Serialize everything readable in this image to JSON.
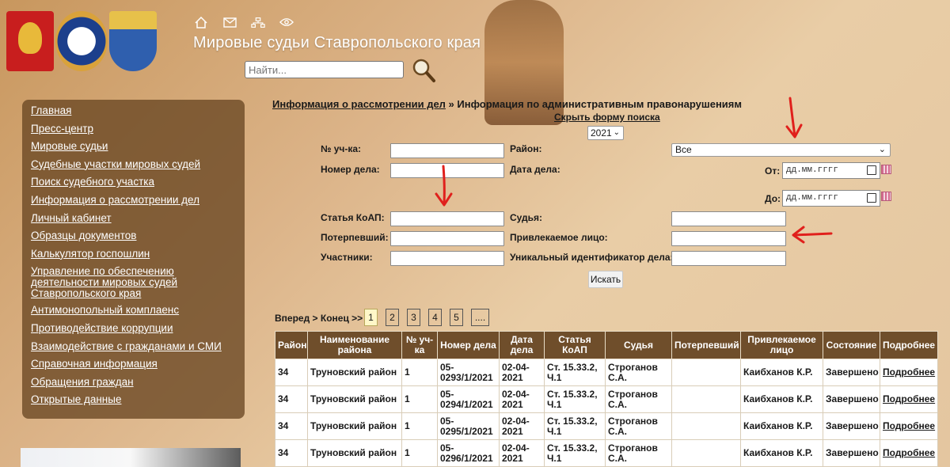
{
  "header": {
    "title": "Мировые судьи Ставропольского края",
    "search_placeholder": "Найти...",
    "icons": [
      "home-icon",
      "mail-icon",
      "sitemap-icon",
      "eye-icon",
      "magnifier-icon"
    ]
  },
  "sidebar": {
    "items": [
      "Главная",
      "Пресс-центр",
      "Мировые судьи",
      "Судебные участки мировых судей",
      "Поиск судебного участка",
      "Информация о рассмотрении дел",
      "Личный кабинет",
      "Образцы документов",
      "Калькулятор госпошлин",
      "Управление по обеспечению деятельности мировых судей Ставропольского края",
      "Антимонопольный комплаенс",
      "Противодействие коррупции",
      "Взаимодействие с гражданами и СМИ",
      "Справочная информация",
      "Обращения граждан",
      "Открытые данные"
    ]
  },
  "breadcrumb": {
    "link": "Информация о рассмотрении дел",
    "separator": " » ",
    "current": "Информация по административным правонарушениям"
  },
  "form": {
    "hide_link": "Скрыть форму поиска",
    "year": "2021",
    "labels": {
      "uchastok": "№ уч-ка:",
      "rayon": "Район:",
      "case_number": "Номер дела:",
      "case_date": "Дата дела:",
      "from": "От:",
      "to": "До:",
      "article": "Статья КоАП:",
      "judge": "Судья:",
      "victim": "Потерпевший:",
      "accused": "Привлекаемое лицо:",
      "participants": "Участники:",
      "uid": "Уникальный идентификатор дела:"
    },
    "district_value": "Все",
    "date_placeholder": "дд.мм.гггг",
    "submit_label": "Искать"
  },
  "pagination": {
    "label": "Вперед > Конец >>",
    "pages": [
      "1",
      "2",
      "3",
      "4",
      "5",
      "...."
    ],
    "current": "1"
  },
  "table": {
    "headers": [
      "Район",
      "Наименование района",
      "№ уч-ка",
      "Номер дела",
      "Дата дела",
      "Статья КоАП",
      "Судья",
      "Потерпевший",
      "Привлекаемое лицо",
      "Состояние",
      "Подробнее"
    ],
    "rows": [
      [
        "34",
        "Труновский район",
        "1",
        "05-0293/1/2021",
        "02-04-2021",
        "Ст. 15.33.2, Ч.1",
        "Строганов С.А.",
        "",
        "Каибханов К.Р.",
        "Завершено",
        "Подробнее"
      ],
      [
        "34",
        "Труновский район",
        "1",
        "05-0294/1/2021",
        "02-04-2021",
        "Ст. 15.33.2, Ч.1",
        "Строганов С.А.",
        "",
        "Каибханов К.Р.",
        "Завершено",
        "Подробнее"
      ],
      [
        "34",
        "Труновский район",
        "1",
        "05-0295/1/2021",
        "02-04-2021",
        "Ст. 15.33.2, Ч.1",
        "Строганов С.А.",
        "",
        "Каибханов К.Р.",
        "Завершено",
        "Подробнее"
      ],
      [
        "34",
        "Труновский район",
        "1",
        "05-0296/1/2021",
        "02-04-2021",
        "Ст. 15.33.2, Ч.1",
        "Строганов С.А.",
        "",
        "Каибханов К.Р.",
        "Завершено",
        "Подробнее"
      ]
    ]
  },
  "colors": {
    "sidebar_bg": "#69461f",
    "table_header_bg": "#6f4e2b",
    "annotation_arrow": "#e0201c",
    "active_page": "#fff7c8"
  }
}
